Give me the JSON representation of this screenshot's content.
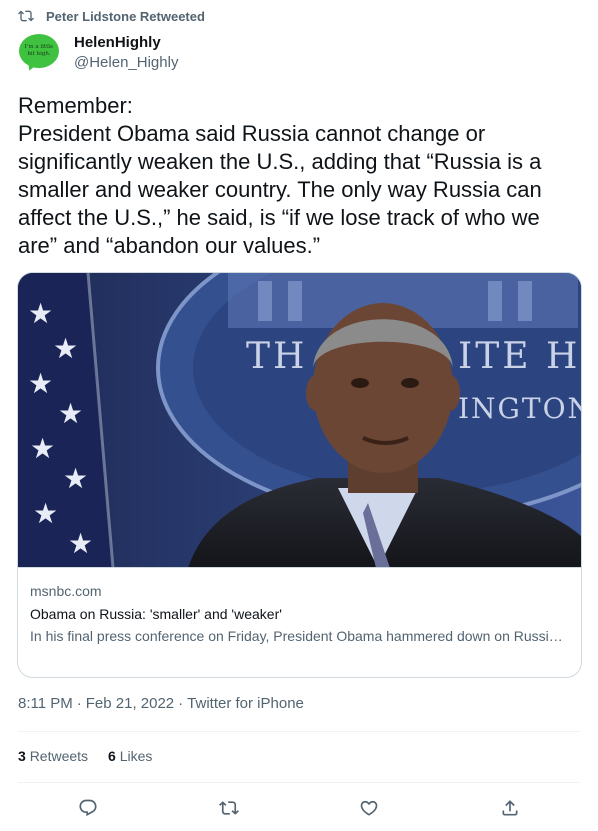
{
  "retweet_banner": {
    "text": "Peter Lidstone Retweeted",
    "icon": "retweet-icon"
  },
  "author": {
    "display_name": "HelenHighly",
    "handle": "@Helen_Highly",
    "avatar_text": "I'm a little bit high.",
    "avatar_color": "#3fc23f"
  },
  "tweet": {
    "lines": [
      "Remember:",
      "President Obama said Russia cannot change or significantly weaken the U.S., adding that “Russia is a smaller and weaker country. The only way Russia can affect the U.S.,” he said, is “if we lose track of who we are” and “abandon our values.”"
    ]
  },
  "card": {
    "domain": "msnbc.com",
    "title": "Obama on Russia: 'smaller' and 'weaker'",
    "description": "In his final press conference on Friday, President Obama hammered down on Russia calling it “smaller” and “weaker,” but is he undermining Russia’s power?...",
    "image_sign_left": "TH",
    "image_sign_right": "ITE H",
    "image_sign_bottom": "INGTON"
  },
  "meta": {
    "time": "8:11 PM",
    "separator": "·",
    "date": "Feb 21, 2022",
    "source": "Twitter for iPhone"
  },
  "stats": {
    "retweets_count": "3",
    "retweets_label": "Retweets",
    "likes_count": "6",
    "likes_label": "Likes"
  },
  "actions": {
    "reply_icon": "reply-icon",
    "retweet_icon": "retweet-icon",
    "like_icon": "like-icon",
    "share_icon": "share-icon"
  },
  "colors": {
    "text_primary": "#0f1419",
    "text_secondary": "#536471",
    "border": "#cfd9de",
    "divider": "#eff3f4"
  }
}
